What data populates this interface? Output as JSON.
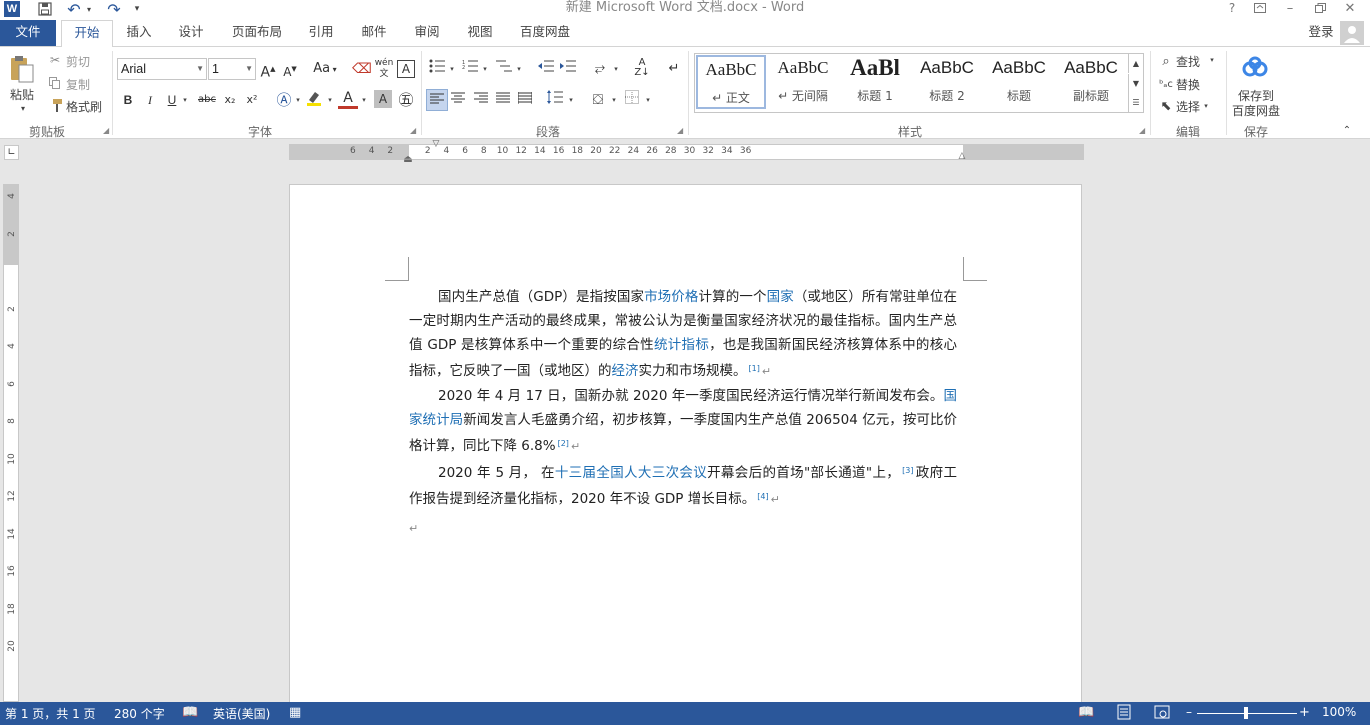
{
  "window": {
    "title": "新建 Microsoft Word 文档.docx - Word"
  },
  "tabs": [
    "文件",
    "开始",
    "插入",
    "设计",
    "页面布局",
    "引用",
    "邮件",
    "审阅",
    "视图",
    "百度网盘"
  ],
  "account": {
    "login": "登录"
  },
  "clipboard": {
    "paste": "粘贴",
    "cut": "剪切",
    "copy": "复制",
    "format_painter": "格式刷",
    "group": "剪贴板"
  },
  "font": {
    "name": "Arial",
    "size": "1",
    "group": "字体",
    "case": "Aa",
    "pinyin": "wén",
    "bold": "B",
    "italic": "I",
    "underline": "U",
    "strike": "abc",
    "sub": "x₂",
    "sup": "x²",
    "color_a": "A"
  },
  "paragraph": {
    "group": "段落"
  },
  "styles": {
    "group": "样式",
    "items": [
      {
        "sample": "AaBbC",
        "name": "↵ 正文"
      },
      {
        "sample": "AaBbC",
        "name": "↵ 无间隔"
      },
      {
        "sample": "AaBl",
        "name": "标题 1"
      },
      {
        "sample": "AaBbC",
        "name": "标题 2"
      },
      {
        "sample": "AaBbC",
        "name": "标题"
      },
      {
        "sample": "AaBbC",
        "name": "副标题"
      }
    ]
  },
  "editing": {
    "find": "查找",
    "replace": "替换",
    "select": "选择",
    "group": "编辑"
  },
  "save": {
    "label_line1": "保存到",
    "label_line2": "百度网盘",
    "group": "保存"
  },
  "ruler": {
    "h": [
      "6",
      "4",
      "2",
      "",
      "2",
      "4",
      "6",
      "8",
      "10",
      "12",
      "14",
      "16",
      "18",
      "20",
      "22",
      "24",
      "26",
      "28",
      "30",
      "32",
      "34",
      "36"
    ],
    "v": [
      "4",
      "2",
      "",
      "2",
      "4",
      "6",
      "8",
      "10",
      "12",
      "14",
      "16",
      "18",
      "20"
    ]
  },
  "document": {
    "p1": [
      {
        "t": "国内生产总值（GDP）是指按国家"
      },
      {
        "t": "市场价格",
        "link": true
      },
      {
        "t": "计算的一个"
      },
      {
        "t": "国家",
        "link": true
      },
      {
        "t": "（或地区）所有常驻单位在一定时期内生产活动的最终成果，常被公认为是衡量国家经济状况的最佳指标。国内生产总值 GDP 是核算体系中一个重要的综合性"
      },
      {
        "t": "统计指标",
        "link": true
      },
      {
        "t": "，也是我国新国民经济核算体系中的核心指标，它反映了一国（或地区）的"
      },
      {
        "t": "经济",
        "link": true
      },
      {
        "t": "实力和市场规模。"
      },
      {
        "t": "[1]",
        "ref": true
      },
      {
        "t": "↵",
        "pm": true
      }
    ],
    "p2": [
      {
        "t": "2020 年 4 月 17 日，国新办就 2020 年一季度国民经济运行情况举行新闻发布会。"
      },
      {
        "t": "国家统计局",
        "link": true
      },
      {
        "t": "新闻发言人毛盛勇介绍，初步核算，一季度国内生产总值 206504 亿元，按可比价格计算，同比下降 6.8%"
      },
      {
        "t": "[2]",
        "ref": true
      },
      {
        "t": "↵",
        "pm": true
      }
    ],
    "p3": [
      {
        "t": "2020 年 5 月，  在"
      },
      {
        "t": "十三届全国人大三次会议",
        "link": true
      },
      {
        "t": "开幕会后的首场\"部长通道\"上，"
      },
      {
        "t": "[3]",
        "ref": true
      },
      {
        "t": "政府工作报告提到经济量化指标，2020 年不设 GDP 增长目标。"
      },
      {
        "t": "[4]",
        "ref": true
      },
      {
        "t": "↵",
        "pm": true
      }
    ],
    "empty_mark": "↵"
  },
  "status": {
    "page": "第 1 页，共 1 页",
    "words": "280 个字",
    "language": "英语(美国)",
    "zoom": "100%"
  },
  "colors": {
    "accent": "#2b579a",
    "link": "#1f6fb4"
  }
}
